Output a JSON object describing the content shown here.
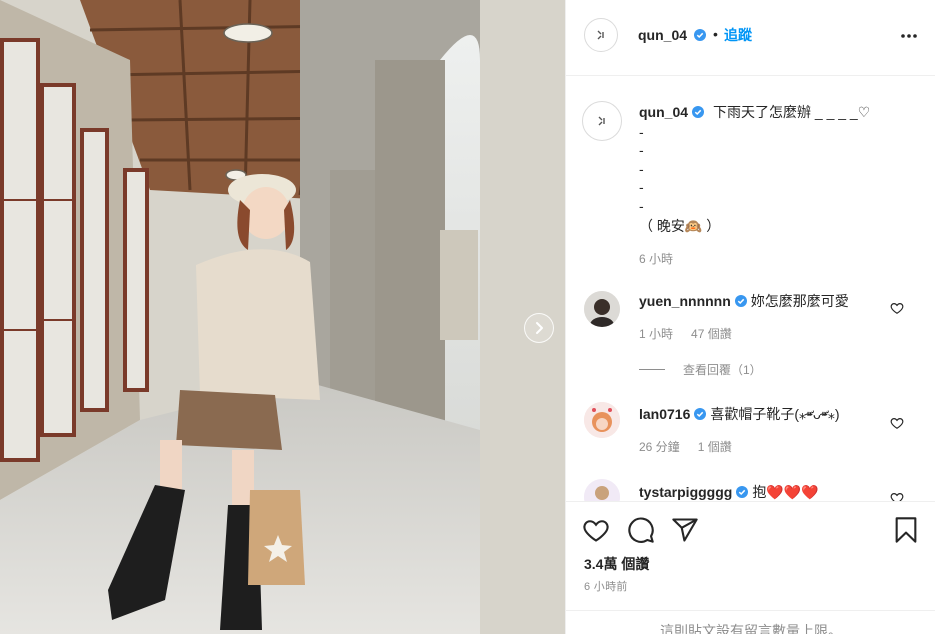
{
  "post": {
    "author": "qun_04",
    "follow_label": "追蹤",
    "separator": "•",
    "caption": {
      "text": "下雨天了怎麼辦 _ _ _ _♡",
      "lines": [
        "-",
        "-",
        "-",
        "-",
        "-",
        "（ 晚安🙉 ）"
      ],
      "time": "6 小時"
    },
    "comments": [
      {
        "user": "yuen_nnnnnn",
        "verified": true,
        "text": "妳怎麼那麼可愛",
        "time": "1 小時",
        "likes": "47 個讚",
        "replies": "查看回覆（1）"
      },
      {
        "user": "lan0716",
        "verified": true,
        "text": "喜歡帽子靴子(⁎⁍̴̛ᴗ⁍̴̛⁎)",
        "time": "26 分鐘",
        "likes": "1 個讚"
      },
      {
        "user": "tystarpiggggg",
        "verified": true,
        "text": "抱❤️❤️❤️"
      }
    ],
    "views": "3.4萬 個讚",
    "posted": "6 小時前",
    "comment_limit": "這則貼文設有留言數量上限。"
  },
  "icons": {
    "verified": "verified-badge-icon",
    "more": "more-options-icon",
    "like": "heart-icon",
    "comment": "comment-icon",
    "share": "share-icon",
    "save": "bookmark-icon",
    "next": "chevron-right-icon"
  },
  "colors": {
    "accent": "#0095f6",
    "text": "#262626",
    "muted": "#8e8e8e",
    "border": "#efefef"
  }
}
